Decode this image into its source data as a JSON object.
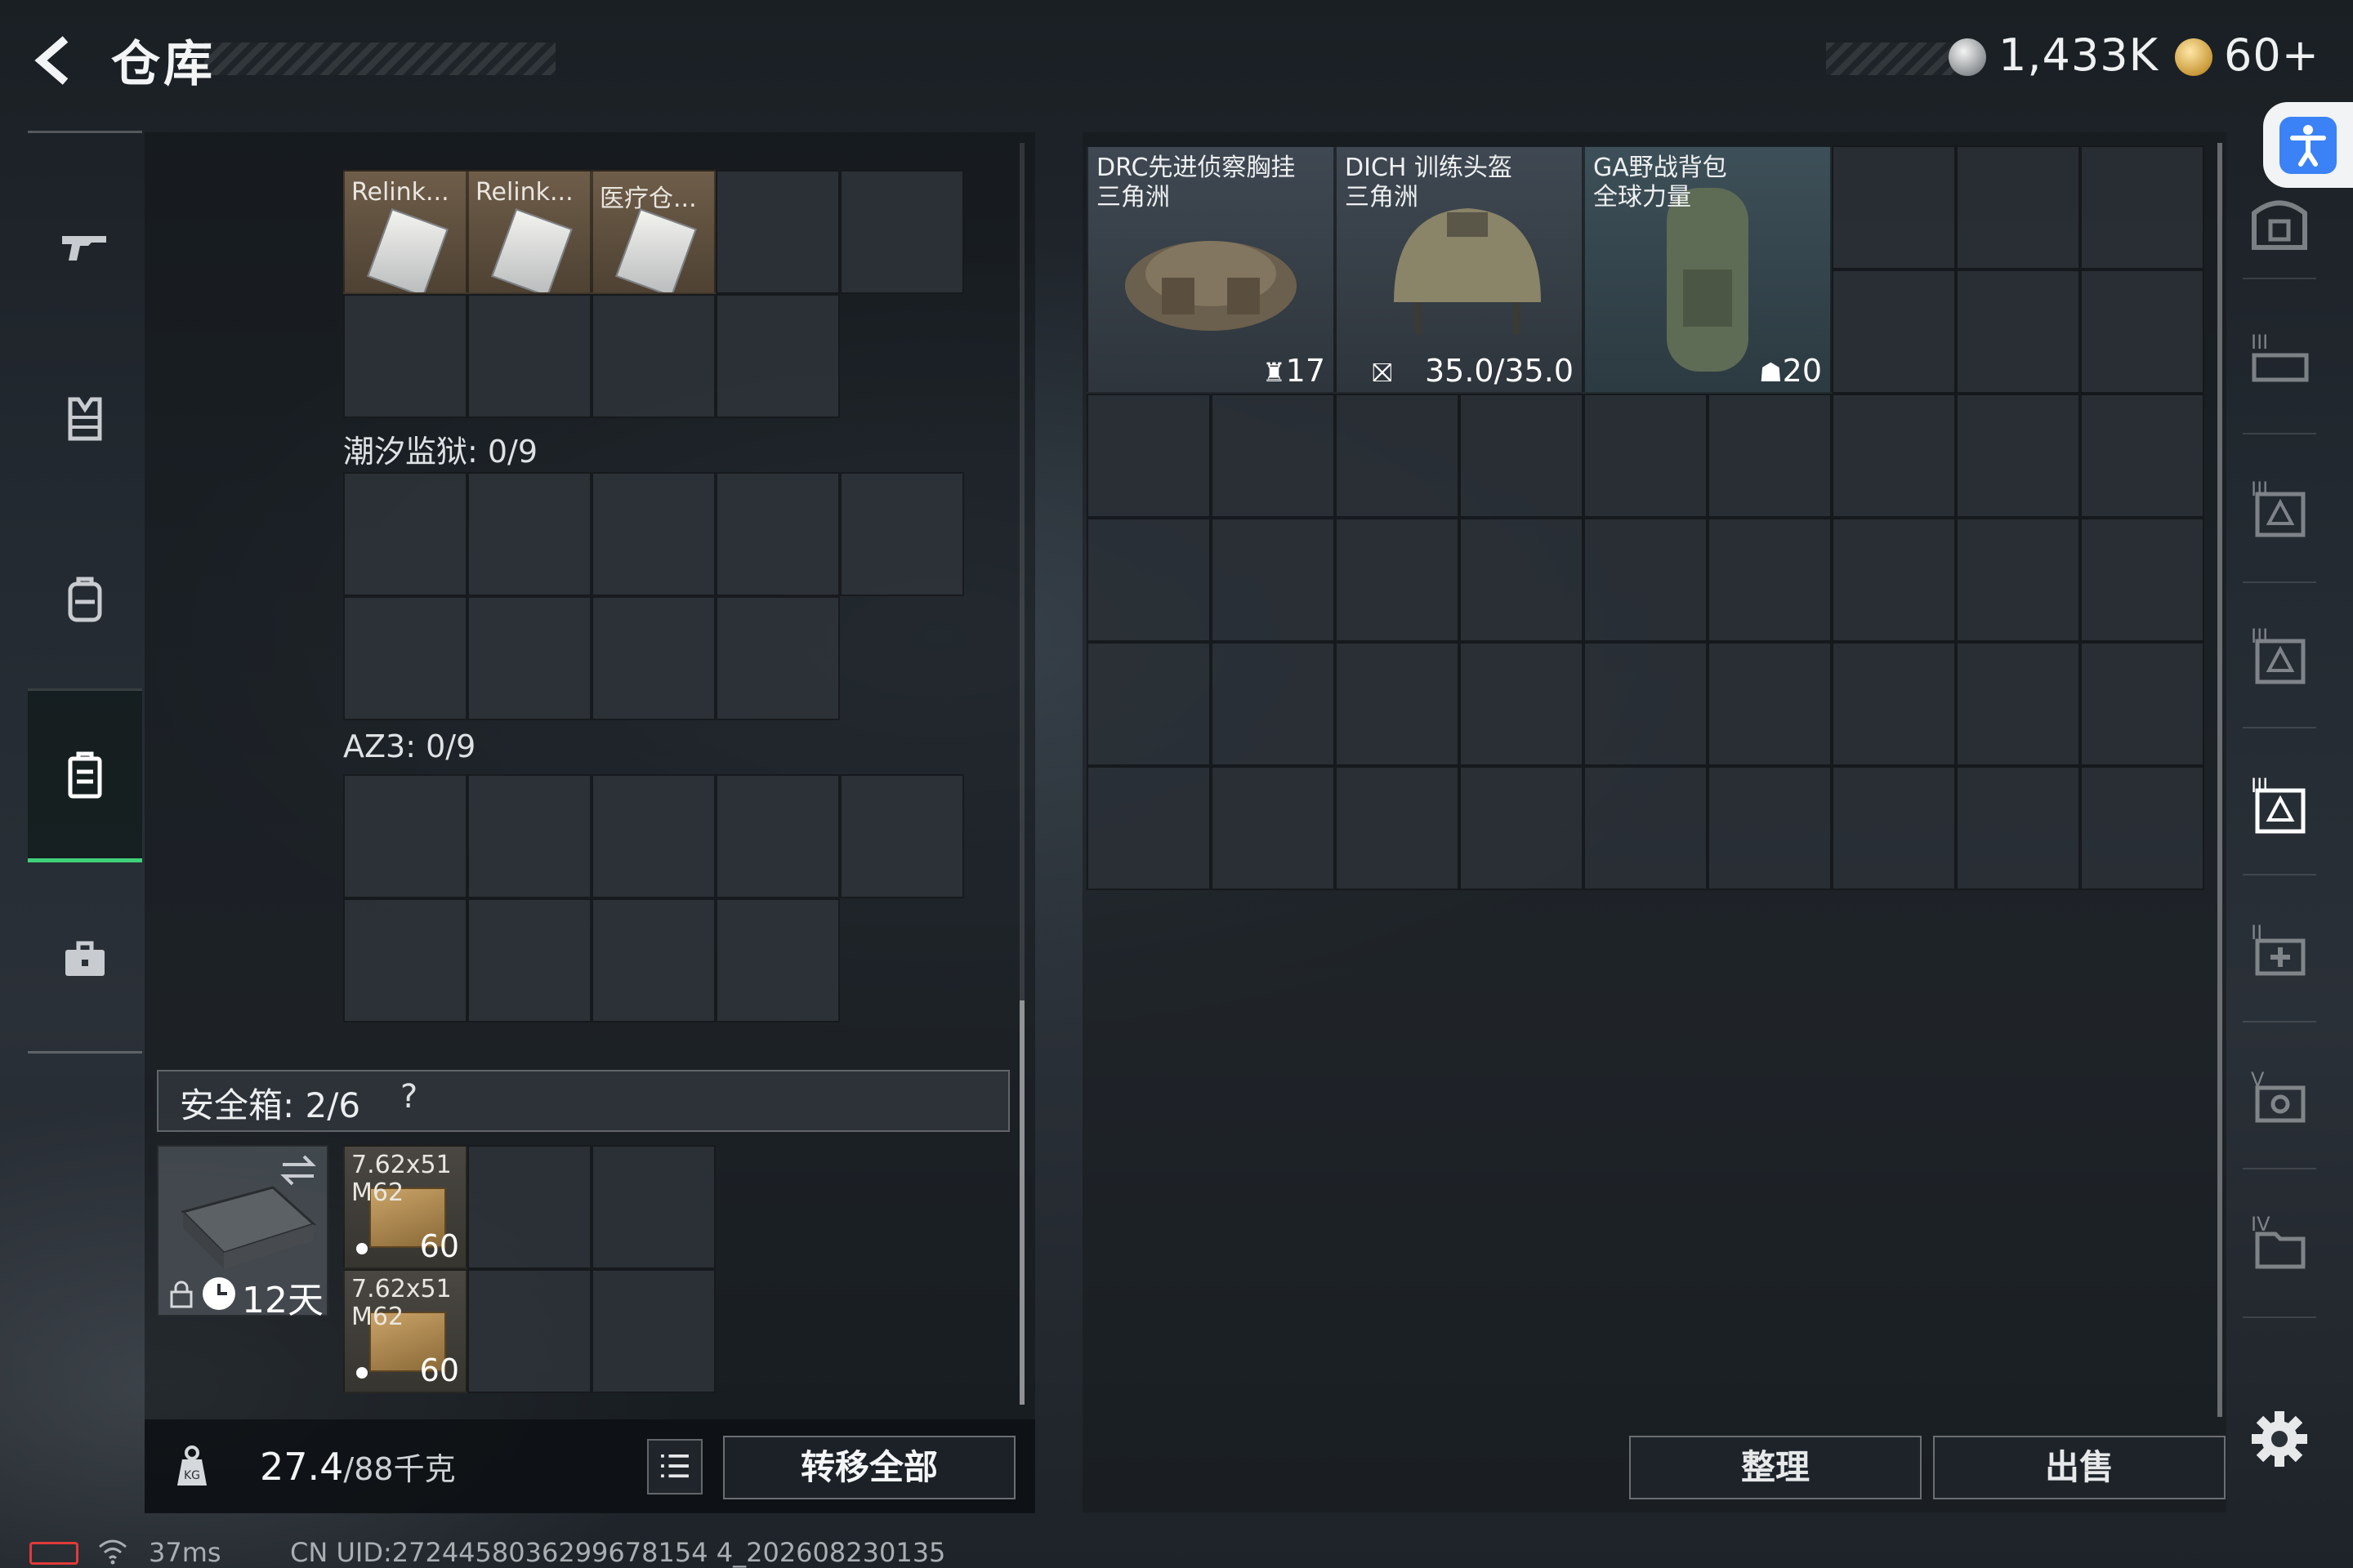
{
  "header": {
    "title": "仓库",
    "currency_silver": "1,433K",
    "currency_gold": "60+"
  },
  "left_nav": {
    "items": [
      "gun-icon",
      "vest-icon",
      "backpack-icon",
      "case-icon",
      "toolbox-icon"
    ],
    "active": "case-icon"
  },
  "containers": [
    {
      "label": "",
      "items": [
        {
          "name": "Relink..."
        },
        {
          "name": "Relink..."
        },
        {
          "name": "医疗仓..."
        }
      ]
    },
    {
      "label": "潮汐监狱: 0/9",
      "items": []
    },
    {
      "label": "AZ3: 0/9",
      "items": []
    }
  ],
  "safebox": {
    "label": "安全箱: 2/6",
    "help": "?",
    "timer": "12天",
    "items": [
      {
        "name_line1": "7.62x51",
        "name_line2": "M62",
        "count": "60"
      },
      {
        "name_line1": "7.62x51",
        "name_line2": "M62",
        "count": "60"
      }
    ]
  },
  "bottom_left": {
    "weight_current": "27.4",
    "weight_max": "/88千克",
    "transfer_all": "转移全部"
  },
  "storage": {
    "items": [
      {
        "name": "DRC先进侦察胸挂",
        "brand": "三角洲",
        "stat": "17",
        "stat_icon": "vest-capacity-icon"
      },
      {
        "name": "DICH 训练头盔",
        "brand": "三角洲",
        "stat": "35.0/35.0",
        "stat_icon": "durability-icon"
      },
      {
        "name": "GA野战背包",
        "brand": "全球力量",
        "stat": "20",
        "stat_icon": "backpack-capacity-icon"
      }
    ]
  },
  "bottom_right": {
    "sort": "整理",
    "sell": "出售"
  },
  "status_bar": {
    "ping": "37ms",
    "uid": "CN UID:2724458036299678154 4_202608230135"
  },
  "colors": {
    "accent_green": "#3fd17a",
    "accessibility_blue": "#3b82f6",
    "battery_red": "#e03a3a"
  }
}
